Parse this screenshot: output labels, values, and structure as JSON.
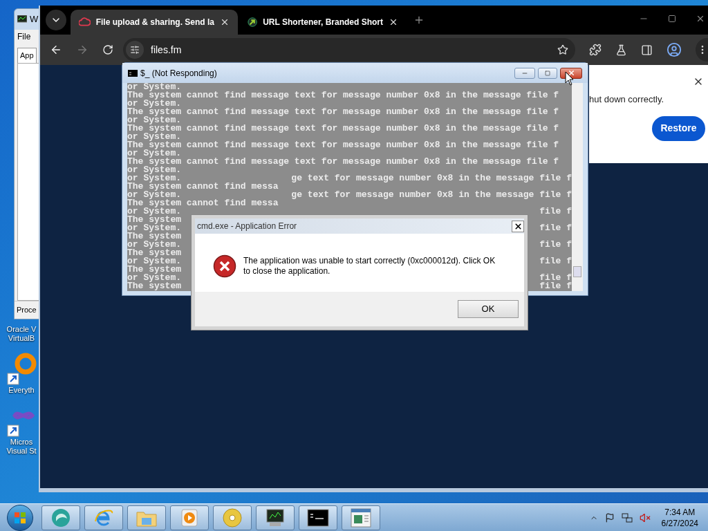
{
  "back_window": {
    "title": "W",
    "menu": [
      "File"
    ],
    "tab": "App",
    "button": "Proce"
  },
  "desktop_icons": [
    {
      "kind": "vbox",
      "label": [
        "Oracle V",
        "VirtualB"
      ]
    },
    {
      "kind": "ring",
      "label": [
        "Everyth"
      ]
    },
    {
      "kind": "infinity",
      "label": [
        "Micros",
        "Visual St"
      ]
    }
  ],
  "browser": {
    "tabs": [
      {
        "kind": "cloud",
        "title": "File upload & sharing. Send la",
        "selected": true
      },
      {
        "kind": "arrow",
        "title": "URL Shortener, Branded Short",
        "selected": false
      }
    ],
    "address": "files.fm",
    "restore_popup": {
      "message": "hut down correctly.",
      "button": "Restore"
    }
  },
  "console": {
    "title": "$_ (Not Responding)",
    "lines": [
      {
        "left": "or System."
      },
      {
        "left": "The system cannot find message text for message number 0x8 in the message file f"
      },
      {
        "left": "or System."
      },
      {
        "left": "The system cannot find message text for message number 0x8 in the message file f"
      },
      {
        "left": "or System."
      },
      {
        "left": "The system cannot find message text for message number 0x8 in the message file f"
      },
      {
        "left": "or System."
      },
      {
        "left": "The system cannot find message text for message number 0x8 in the message file f"
      },
      {
        "left": "or System."
      },
      {
        "left": "The system cannot find message text for message number 0x8 in the message file f"
      },
      {
        "left": "or System."
      },
      {
        "left": "or System.",
        "right": "ge text for message number 0x8 in the message file f"
      },
      {
        "left": "The system cannot find messa"
      },
      {
        "left": "or System.",
        "right": "ge text for message number 0x8 in the message file f"
      },
      {
        "left": "The system cannot find messa"
      },
      {
        "left": "or System.",
        "right": "file f"
      },
      {
        "left": "The system"
      },
      {
        "left": "or System.",
        "right": "file f"
      },
      {
        "left": "The system"
      },
      {
        "left": "or System.",
        "right": "file f"
      },
      {
        "left": "The system"
      },
      {
        "left": "or System.",
        "right": "file f"
      },
      {
        "left": "The system"
      },
      {
        "left": "or System.",
        "right": "file f"
      },
      {
        "left": "The system",
        "right": "file f"
      }
    ]
  },
  "dialog": {
    "title": "cmd.exe - Application Error",
    "message": "The application was unable to start correctly (0xc000012d). Click OK to close the application.",
    "button": "OK"
  },
  "taskbar": {
    "apps": [
      {
        "kind": "sphere"
      },
      {
        "kind": "ie"
      },
      {
        "kind": "folder"
      },
      {
        "kind": "media"
      },
      {
        "kind": "disc"
      },
      {
        "kind": "monitor"
      },
      {
        "kind": "cmd"
      },
      {
        "kind": "window"
      }
    ],
    "time": "7:34 AM",
    "date": "6/27/2024"
  }
}
